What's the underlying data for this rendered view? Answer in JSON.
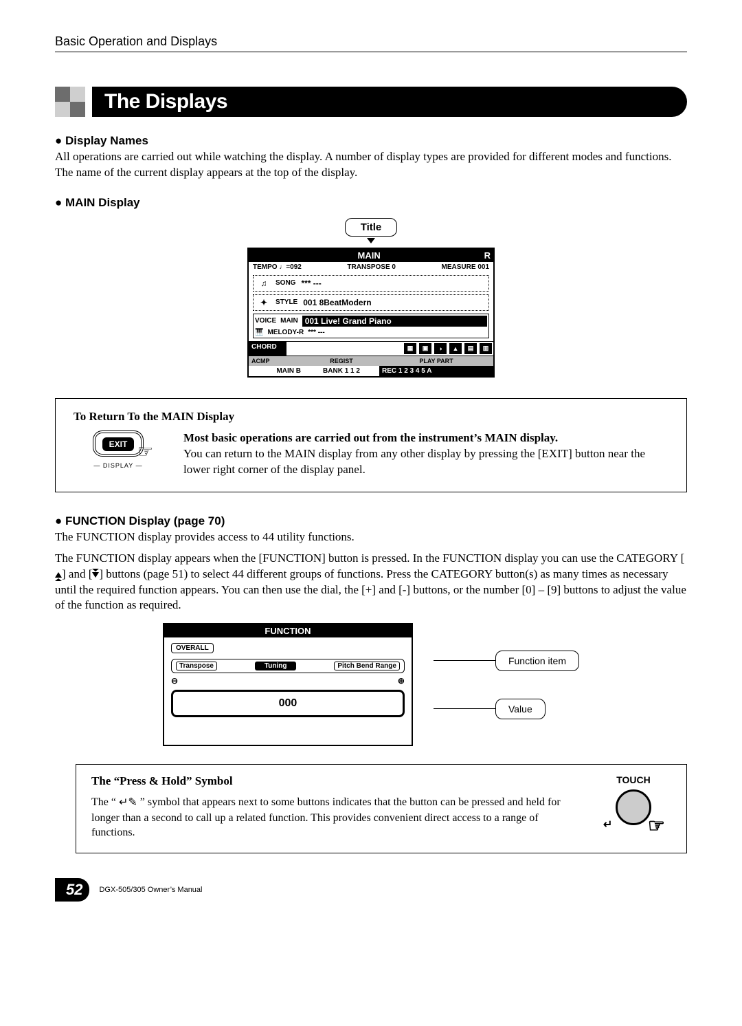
{
  "runningHead": "Basic Operation and Displays",
  "sectionTitle": "The Displays",
  "displayNames": {
    "heading": "Display Names",
    "para": "All operations are carried out while watching the display. A number of display types are provided for different modes and functions. The name of the current display appears at the top of the display."
  },
  "mainDisplay": {
    "heading": "MAIN Display",
    "titleCallout": "Title",
    "lcd": {
      "screenTitle": "MAIN",
      "tempo": "TEMPO ♩=092",
      "transpose": "TRANSPOSE 0",
      "measure": "MEASURE 001",
      "songLabel": "SONG",
      "songValue": "*** ---",
      "styleLabel": "STYLE",
      "styleValue": "001 8BeatModern",
      "voiceLabel": "VOICE",
      "mainLabel": "MAIN",
      "mainValue": "001 Live! Grand Piano",
      "melodyLabel": "MELODY-R",
      "melodyValue": "*** ---",
      "chordLabel": "CHORD",
      "acmpLabel": "ACMP",
      "mainB": "MAIN B",
      "registLabel": "REGIST",
      "bank": "BANK 1   1 2",
      "playPartLabel": "PLAY PART",
      "rec": "REC 1 2 3 4 5 A"
    }
  },
  "returnBox": {
    "title": "To Return To the MAIN Display",
    "exitLabel": "EXIT",
    "displayLabel": "DISPLAY",
    "boldLine": "Most basic operations are carried out from the instrument’s MAIN display.",
    "rest": "You can return to the MAIN display from any other display by pressing the [EXIT] button near the lower right corner of the display panel."
  },
  "functionDisplay": {
    "heading": "FUNCTION Display (page 70)",
    "para1": "The FUNCTION display provides access to 44 utility functions.",
    "para2a": "The FUNCTION display appears when the [FUNCTION] button is pressed. In the FUNCTION display you can use the CATEGORY [",
    "para2b": "] and [",
    "para2c": "] buttons (page 51) to select 44 different groups of functions. Press the CATEGORY button(s) as many times as necessary until the required function appears. You can then use the dial, the [+] and [-] buttons, or the number [0] – [9] buttons to adjust the value of the function as required.",
    "lcd": {
      "screenTitle": "FUNCTION",
      "category": "OVERALL",
      "left": "Transpose",
      "mid": "Tuning",
      "right": "Pitch Bend Range",
      "value": "000"
    },
    "calloutItem": "Function item",
    "calloutValue": "Value"
  },
  "pressHold": {
    "title": "The “Press & Hold” Symbol",
    "textA": "The “ ",
    "textB": " ” symbol that appears next to some buttons indicates that the button can be pressed and held for longer than a second to call up a related function. This provides convenient direct access to a range of functions.",
    "touchLabel": "TOUCH"
  },
  "footer": {
    "pageNo": "52",
    "manual": "DGX-505/305  Owner’s Manual"
  }
}
